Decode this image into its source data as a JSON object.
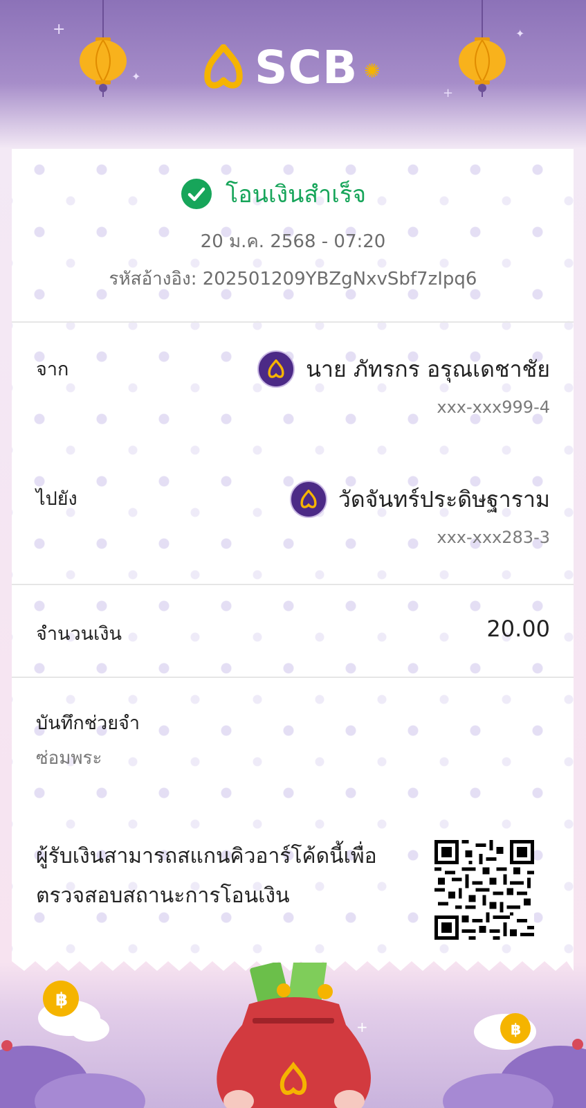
{
  "brand": {
    "name": "SCB",
    "primary": "#4c2a86",
    "gold": "#f5b400",
    "success": "#17a55a"
  },
  "status": {
    "title": "โอนเงินสำเร็จ",
    "icon": "check-circle-icon"
  },
  "transaction": {
    "datetime": "20 ม.ค. 2568 - 07:20",
    "ref_label": "รหัสอ้างอิง:",
    "ref_value": "202501209YBZgNxvSbf7zIpq6"
  },
  "from": {
    "label": "จาก",
    "name": "นาย ภัทรกร อรุณเดชาชัย",
    "account": "xxx-xxx999-4",
    "bank_icon": "scb-bank-icon"
  },
  "to": {
    "label": "ไปยัง",
    "name": "วัดจันทร์ประดิษฐาราม",
    "account": "xxx-xxx283-3",
    "bank_icon": "scb-bank-icon"
  },
  "amount": {
    "label": "จำนวนเงิน",
    "value": "20.00"
  },
  "memo": {
    "label": "บันทึกช่วยจำ",
    "value": "ซ่อมพระ"
  },
  "qr": {
    "line1": "ผู้รับเงินสามารถสแกนคิวอาร์โค้ดนี้เพื่อ",
    "line2": "ตรวจสอบสถานะการโอนเงิน"
  }
}
